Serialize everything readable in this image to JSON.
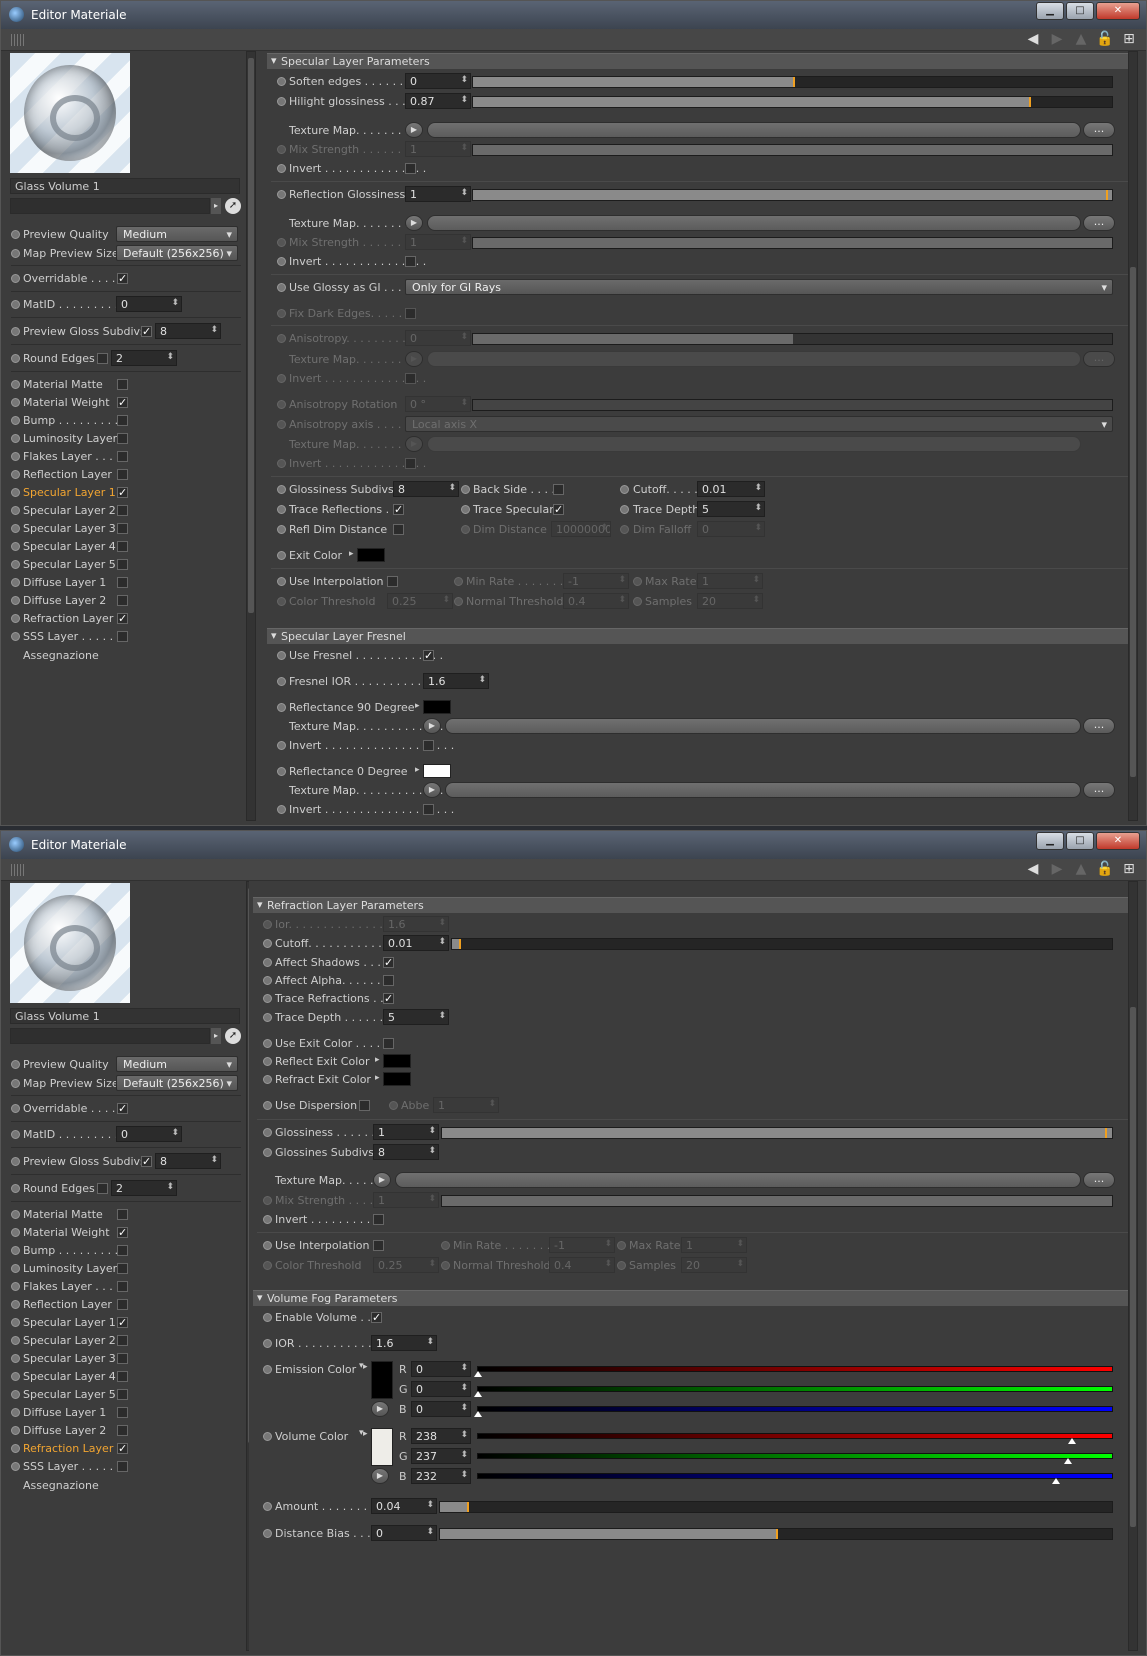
{
  "windows": [
    {
      "title": "Editor Materiale",
      "material_name": "Glass Volume 1",
      "left_params": {
        "preview_quality": {
          "label": "Preview Quality",
          "value": "Medium"
        },
        "map_preview_size": {
          "label": "Map Preview Size",
          "value": "Default (256x256)"
        },
        "overridable": {
          "label": "Overridable . . . .",
          "checked": true
        },
        "matid": {
          "label": "MatID . . . . . . . . .",
          "value": "0"
        },
        "preview_gloss_subdivs": {
          "label": "Preview Gloss Subdivs",
          "value": "8"
        },
        "round_edges": {
          "label": "Round Edges",
          "value": "2"
        }
      },
      "channels": [
        {
          "label": "Material Matte",
          "checked": false
        },
        {
          "label": "Material Weight",
          "checked": true
        },
        {
          "label": "Bump . . . . . . . . .",
          "checked": false
        },
        {
          "label": "Luminosity Layer",
          "checked": false
        },
        {
          "label": "Flakes Layer . . . .",
          "checked": false
        },
        {
          "label": "Reflection Layer",
          "checked": false
        },
        {
          "label": "Specular Layer 1",
          "checked": true,
          "active": true
        },
        {
          "label": "Specular Layer 2",
          "checked": false
        },
        {
          "label": "Specular Layer 3",
          "checked": false
        },
        {
          "label": "Specular Layer 4",
          "checked": false
        },
        {
          "label": "Specular Layer 5",
          "checked": false
        },
        {
          "label": "Diffuse Layer 1",
          "checked": false
        },
        {
          "label": "Diffuse Layer 2",
          "checked": false
        },
        {
          "label": "Refraction Layer",
          "checked": true
        },
        {
          "label": "SSS Layer . . . . . .",
          "checked": false
        }
      ],
      "assign_label": "Assegnazione",
      "sections": {
        "spec_params": "Specular Layer Parameters",
        "soften_edges": {
          "label": "Soften edges . . . . . . . .",
          "value": "0"
        },
        "hilight_glossiness": {
          "label": "Hilight glossiness . . .",
          "value": "0.87",
          "level": 0.87
        },
        "texture_map": "Texture Map. . . . . . . . .",
        "mix_strength": {
          "label": "Mix Strength . . . . . . . .",
          "value": "1"
        },
        "invert": "Invert . . . . . . . . . . . . . . .",
        "refl_gloss": {
          "label": "Reflection Glossiness",
          "value": "1",
          "level": 1
        },
        "use_glossy_gi": {
          "label": "Use Glossy as GI . . . .",
          "value": "Only for GI Rays"
        },
        "fix_dark_edges": "Fix Dark Edges. . . . . . .",
        "anisotropy": {
          "label": "Anisotropy. . . . . . . . . .",
          "value": "0",
          "level": 0.5
        },
        "aniso_rotation": {
          "label": "Anisotropy Rotation",
          "value": "0 °"
        },
        "aniso_axis": {
          "label": "Anisotropy axis . . . . .",
          "value": "Local axis X"
        },
        "gloss_subdivs": {
          "label": "Glossiness Subdivs",
          "value": "8"
        },
        "back_side": "Back Side . . . .",
        "cutoff": {
          "label": "Cutoff. . . . . . .",
          "value": "0.01"
        },
        "trace_reflections": "Trace Reflections . .",
        "trace_specular": "Trace Specular",
        "trace_depth": {
          "label": "Trace Depth",
          "value": "5"
        },
        "refl_dim_distance": "Refl Dim Distance",
        "dim_distance": {
          "label": "Dim Distance",
          "value": "100000000"
        },
        "dim_falloff": {
          "label": "Dim Falloff",
          "value": "0"
        },
        "exit_color": "Exit Color",
        "use_interpolation": "Use Interpolation",
        "min_rate": {
          "label": "Min Rate . . . . . . .",
          "value": "-1"
        },
        "max_rate": {
          "label": "Max Rate",
          "value": "1"
        },
        "color_threshold": {
          "label": "Color Threshold",
          "value": "0.25"
        },
        "normal_threshold": {
          "label": "Normal Threshold",
          "value": "0.4"
        },
        "samples": {
          "label": "Samples",
          "value": "20"
        },
        "fresnel_head": "Specular Layer Fresnel",
        "use_fresnel": "Use Fresnel . . . . . . . . . . . . .",
        "fresnel_ior": {
          "label": "Fresnel IOR . . . . . . . . . . . .",
          "value": "1.6"
        },
        "refl90": "Reflectance 90 Degree",
        "refl0": "Reflectance   0 Degree",
        "texture_map2": "Texture Map. . . . . . . . . . . . .",
        "invert2": "Invert . . . . . . . . . . . . . . . . . . .",
        "more": "..."
      }
    },
    {
      "title": "Editor Materiale",
      "material_name": "Glass Volume 1",
      "channels_active": "Refraction Layer",
      "sections": {
        "refr_head": "Refraction Layer Parameters",
        "ior": {
          "label": "Ior. . . . . . . . . . . . . . . . . .",
          "value": "1.6"
        },
        "cutoff": {
          "label": "Cutoff. . . . . . . . . . . . . .",
          "value": "0.01"
        },
        "affect_shadows": "Affect Shadows . . . .",
        "affect_alpha": "Affect Alpha. . . . . . .",
        "trace_refractions": "Trace Refractions . . .",
        "trace_depth": {
          "label": "Trace Depth . . . . . . . .",
          "value": "5"
        },
        "use_exit_color": "Use Exit Color . . . . . .",
        "reflect_exit_color": "Reflect Exit Color",
        "refract_exit_color": "Refract Exit Color",
        "use_dispersion": "Use Dispersion",
        "abbe": {
          "label": "Abbe",
          "value": "1"
        },
        "glossiness": {
          "label": "Glossiness . . . . . . .",
          "value": "1",
          "level": 1
        },
        "gloss_subdivs": {
          "label": "Glossines Subdivs",
          "value": "8"
        },
        "texture_map": "Texture Map. . . . .",
        "mix_strength": {
          "label": "Mix Strength . . . . .",
          "value": "1"
        },
        "invert": "Invert . . . . . . . . . . .",
        "use_interpolation": "Use Interpolation",
        "min_rate": {
          "label": "Min Rate . . . . . . .",
          "value": "-1"
        },
        "max_rate": {
          "label": "Max Rate",
          "value": "1"
        },
        "color_threshold": {
          "label": "Color Threshold",
          "value": "0.25"
        },
        "normal_threshold": {
          "label": "Normal Threshold",
          "value": "0.4"
        },
        "samples": {
          "label": "Samples",
          "value": "20"
        },
        "fog_head": "Volume Fog Parameters",
        "enable_volume": "Enable Volume . . .",
        "ior2": {
          "label": "IOR . . . . . . . . . . . . . .",
          "value": "1.6"
        },
        "emission_color": {
          "label": "Emission Color",
          "r": "0",
          "g": "0",
          "b": "0",
          "color": "#000000"
        },
        "volume_color": {
          "label": "Volume Color",
          "r": "238",
          "g": "237",
          "b": "232",
          "color": "#eeede8"
        },
        "amount": {
          "label": "Amount . . . . . . . . . .",
          "value": "0.04",
          "level": 0.04
        },
        "distance_bias": {
          "label": "Distance Bias . . . . .",
          "value": "0",
          "level": 0.5
        },
        "rgb": {
          "r": "R",
          "g": "G",
          "b": "B"
        },
        "more": "..."
      }
    }
  ]
}
